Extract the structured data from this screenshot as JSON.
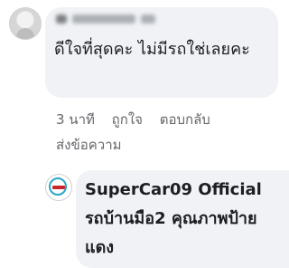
{
  "comment": {
    "author_name_obscured": true,
    "text": "ดีใจที่สุดคะ ไม่มีรถใช่เลยคะ"
  },
  "actions": {
    "time": "3 นาที",
    "like": "ถูกใจ",
    "reply": "ตอบกลับ",
    "send_message": "ส่งข้อความ"
  },
  "reply": {
    "text": "SuperCar09 Official รถบ้านมือ2 คุณภาพป้ายแดง"
  },
  "colors": {
    "bubble": "#f0f2f5",
    "text": "#1c1e21",
    "secondary_text": "#65676b"
  }
}
